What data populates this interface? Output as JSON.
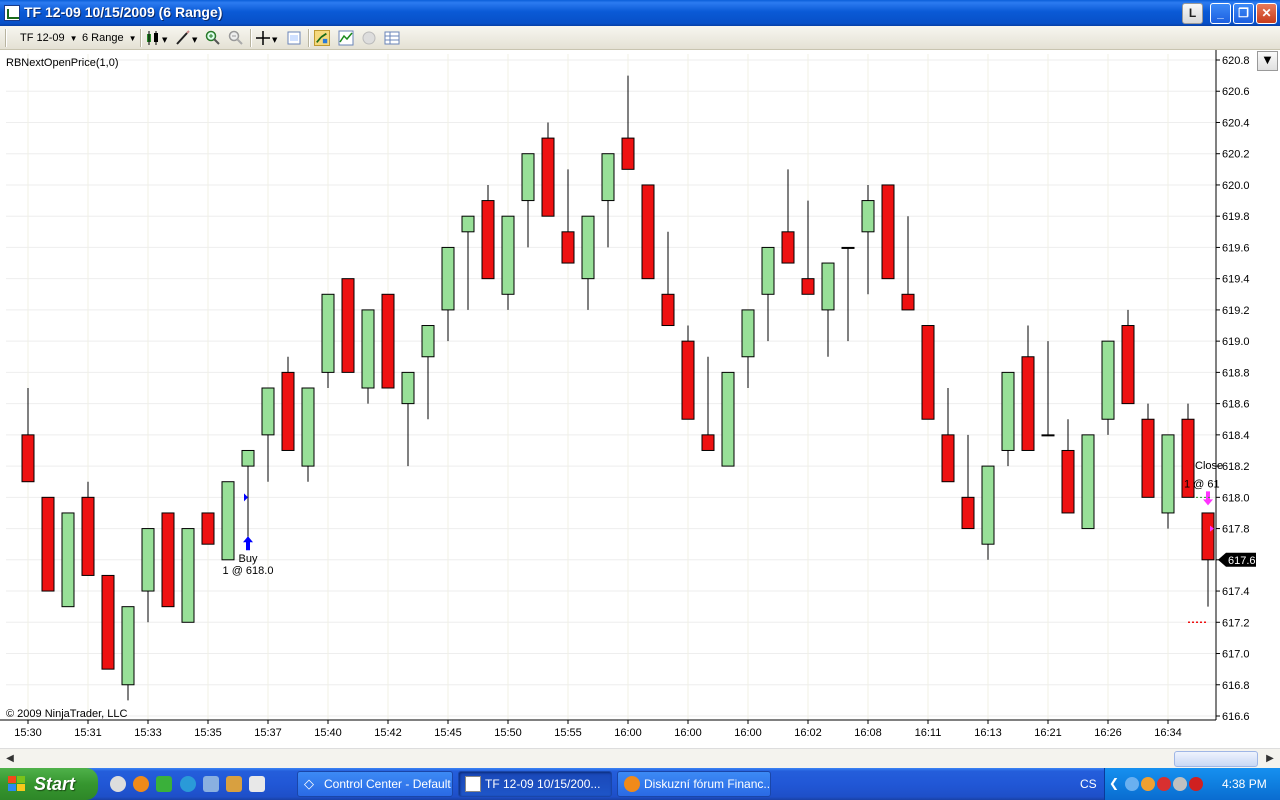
{
  "window": {
    "title": "TF 12-09  10/15/2009 (6 Range)",
    "btn_l": "L",
    "btn_min": "_",
    "btn_max": "❐",
    "btn_close": "✕"
  },
  "toolbar": {
    "instrument": "TF 12-09",
    "period": "6 Range"
  },
  "chart": {
    "indicator_label": "RBNextOpenPrice(1,0)",
    "copyright": "© 2009 NinjaTrader, LLC",
    "current_price": "617.6",
    "colors": {
      "up": "#98e098",
      "down": "#ee1111",
      "buy_arrow": "#0000ff",
      "sell_arrow": "#ff33ff"
    }
  },
  "chart_data": {
    "type": "candlestick",
    "y_ticks": [
      "620.8",
      "620.6",
      "620.4",
      "620.2",
      "620.0",
      "619.8",
      "619.6",
      "619.4",
      "619.2",
      "619.0",
      "618.8",
      "618.6",
      "618.4",
      "618.2",
      "618.0",
      "617.8",
      "617.6",
      "617.4",
      "617.2",
      "617.0",
      "616.8",
      "616.6"
    ],
    "ylim": [
      616.6,
      620.8
    ],
    "x_ticks": [
      "15:30",
      "15:31",
      "15:33",
      "15:35",
      "15:37",
      "15:40",
      "15:42",
      "15:45",
      "15:50",
      "15:55",
      "16:00",
      "16:00",
      "16:00",
      "16:02",
      "16:08",
      "16:11",
      "16:13",
      "16:21",
      "16:26",
      "16:34"
    ],
    "candles": [
      {
        "o": 618.4,
        "h": 618.7,
        "l": 618.1,
        "c": 618.1
      },
      {
        "o": 618.0,
        "h": 618.0,
        "l": 617.4,
        "c": 617.4
      },
      {
        "o": 617.3,
        "h": 617.9,
        "l": 617.3,
        "c": 617.9
      },
      {
        "o": 618.0,
        "h": 618.1,
        "l": 617.5,
        "c": 617.5
      },
      {
        "o": 617.5,
        "h": 617.5,
        "l": 616.9,
        "c": 616.9
      },
      {
        "o": 616.8,
        "h": 617.3,
        "l": 616.7,
        "c": 617.3
      },
      {
        "o": 617.4,
        "h": 617.8,
        "l": 617.2,
        "c": 617.8
      },
      {
        "o": 617.9,
        "h": 617.9,
        "l": 617.3,
        "c": 617.3
      },
      {
        "o": 617.2,
        "h": 617.8,
        "l": 617.2,
        "c": 617.8
      },
      {
        "o": 617.9,
        "h": 617.9,
        "l": 617.7,
        "c": 617.7
      },
      {
        "o": 617.6,
        "h": 618.1,
        "l": 617.6,
        "c": 618.1
      },
      {
        "o": 618.2,
        "h": 618.3,
        "l": 617.7,
        "c": 618.3
      },
      {
        "o": 618.4,
        "h": 618.7,
        "l": 618.1,
        "c": 618.7
      },
      {
        "o": 618.8,
        "h": 618.9,
        "l": 618.3,
        "c": 618.3
      },
      {
        "o": 618.2,
        "h": 618.7,
        "l": 618.1,
        "c": 618.7
      },
      {
        "o": 618.8,
        "h": 619.3,
        "l": 618.7,
        "c": 619.3
      },
      {
        "o": 619.4,
        "h": 619.4,
        "l": 618.8,
        "c": 618.8
      },
      {
        "o": 618.7,
        "h": 619.2,
        "l": 618.6,
        "c": 619.2
      },
      {
        "o": 619.3,
        "h": 619.3,
        "l": 618.7,
        "c": 618.7
      },
      {
        "o": 618.6,
        "h": 618.8,
        "l": 618.2,
        "c": 618.8
      },
      {
        "o": 618.9,
        "h": 619.1,
        "l": 618.5,
        "c": 619.1
      },
      {
        "o": 619.2,
        "h": 619.6,
        "l": 619.0,
        "c": 619.6
      },
      {
        "o": 619.7,
        "h": 619.8,
        "l": 619.2,
        "c": 619.8
      },
      {
        "o": 619.9,
        "h": 620.0,
        "l": 619.4,
        "c": 619.4
      },
      {
        "o": 619.3,
        "h": 619.8,
        "l": 619.2,
        "c": 619.8
      },
      {
        "o": 619.9,
        "h": 620.2,
        "l": 619.6,
        "c": 620.2
      },
      {
        "o": 620.3,
        "h": 620.4,
        "l": 619.8,
        "c": 619.8
      },
      {
        "o": 619.7,
        "h": 620.1,
        "l": 619.5,
        "c": 619.5
      },
      {
        "o": 619.4,
        "h": 619.8,
        "l": 619.2,
        "c": 619.8
      },
      {
        "o": 619.9,
        "h": 620.2,
        "l": 619.6,
        "c": 620.2
      },
      {
        "o": 620.3,
        "h": 620.7,
        "l": 620.1,
        "c": 620.1
      },
      {
        "o": 620.0,
        "h": 620.0,
        "l": 619.4,
        "c": 619.4
      },
      {
        "o": 619.3,
        "h": 619.7,
        "l": 619.1,
        "c": 619.1
      },
      {
        "o": 619.0,
        "h": 619.1,
        "l": 618.5,
        "c": 618.5
      },
      {
        "o": 618.4,
        "h": 618.9,
        "l": 618.3,
        "c": 618.3
      },
      {
        "o": 618.2,
        "h": 618.8,
        "l": 618.2,
        "c": 618.8
      },
      {
        "o": 618.9,
        "h": 619.2,
        "l": 618.7,
        "c": 619.2
      },
      {
        "o": 619.3,
        "h": 619.6,
        "l": 619.0,
        "c": 619.6
      },
      {
        "o": 619.7,
        "h": 620.1,
        "l": 619.5,
        "c": 619.5
      },
      {
        "o": 619.4,
        "h": 619.9,
        "l": 619.3,
        "c": 619.3
      },
      {
        "o": 619.2,
        "h": 619.5,
        "l": 618.9,
        "c": 619.5
      },
      {
        "o": 619.6,
        "h": 619.6,
        "l": 619.0,
        "c": 619.6
      },
      {
        "o": 619.7,
        "h": 620.0,
        "l": 619.3,
        "c": 619.9
      },
      {
        "o": 620.0,
        "h": 620.0,
        "l": 619.4,
        "c": 619.4
      },
      {
        "o": 619.3,
        "h": 619.8,
        "l": 619.2,
        "c": 619.2
      },
      {
        "o": 619.1,
        "h": 619.1,
        "l": 618.5,
        "c": 618.5
      },
      {
        "o": 618.4,
        "h": 618.7,
        "l": 618.1,
        "c": 618.1
      },
      {
        "o": 618.0,
        "h": 618.4,
        "l": 617.8,
        "c": 617.8
      },
      {
        "o": 617.7,
        "h": 618.2,
        "l": 617.6,
        "c": 618.2
      },
      {
        "o": 618.3,
        "h": 618.8,
        "l": 618.2,
        "c": 618.8
      },
      {
        "o": 618.9,
        "h": 619.1,
        "l": 618.3,
        "c": 618.3
      },
      {
        "o": 618.4,
        "h": 619.0,
        "l": 618.4,
        "c": 618.4
      },
      {
        "o": 618.3,
        "h": 618.5,
        "l": 617.9,
        "c": 617.9
      },
      {
        "o": 617.8,
        "h": 618.4,
        "l": 617.8,
        "c": 618.4
      },
      {
        "o": 618.5,
        "h": 619.0,
        "l": 618.4,
        "c": 619.0
      },
      {
        "o": 619.1,
        "h": 619.2,
        "l": 618.6,
        "c": 618.6
      },
      {
        "o": 618.5,
        "h": 618.6,
        "l": 618.0,
        "c": 618.0
      },
      {
        "o": 617.9,
        "h": 618.4,
        "l": 617.8,
        "c": 618.4
      },
      {
        "o": 618.5,
        "h": 618.6,
        "l": 618.0,
        "c": 618.0
      },
      {
        "o": 617.9,
        "h": 617.9,
        "l": 617.3,
        "c": 617.6
      }
    ],
    "annotations": [
      {
        "label": "Buy",
        "detail": "1 @ 618.0"
      },
      {
        "label": "Close",
        "detail": "1 @ 61"
      }
    ]
  },
  "taskbar": {
    "start_label": "Start",
    "tasks": [
      {
        "label": "Control Center - Default",
        "active": false
      },
      {
        "label": "TF 12-09  10/15/200...",
        "active": true
      },
      {
        "label": "Diskuzní fórum Financ...",
        "active": false
      }
    ],
    "lang": "CS",
    "clock": "4:38 PM"
  }
}
